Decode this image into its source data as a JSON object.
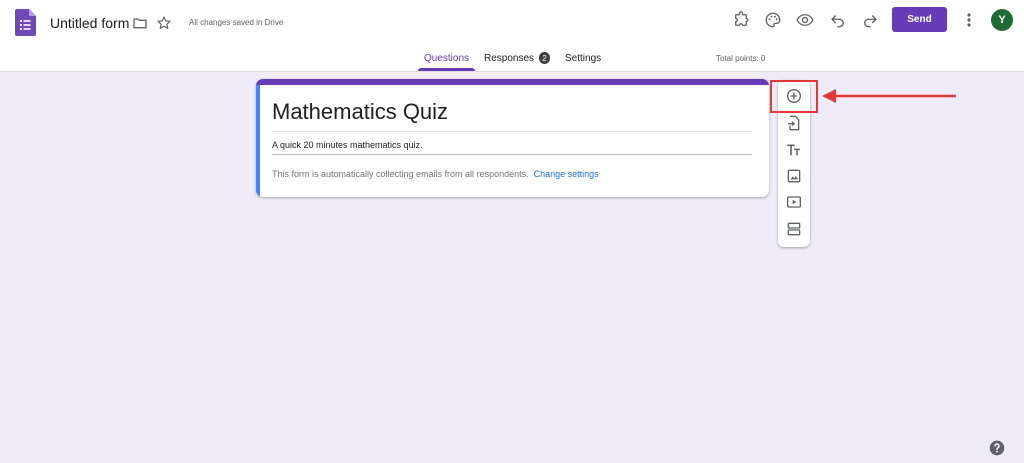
{
  "header": {
    "doc_title": "Untitled form",
    "save_status": "All changes saved in Drive",
    "send_label": "Send",
    "avatar_initial": "Y",
    "icons": [
      "forms-logo-icon",
      "folder-icon",
      "star-icon",
      "addon-puzzle-icon",
      "palette-icon",
      "preview-eye-icon",
      "undo-icon",
      "redo-icon",
      "more-vert-icon"
    ]
  },
  "tabs": [
    {
      "label": "Questions",
      "active": true
    },
    {
      "label": "Responses",
      "badge": "2"
    },
    {
      "label": "Settings"
    }
  ],
  "total_points": "Total points: 0",
  "form": {
    "title": "Mathematics Quiz",
    "description": "A quick 20 minutes mathematics quiz.",
    "email_note": "This form is automatically collecting emails from all respondents.",
    "email_link": "Change settings"
  },
  "toolbar": [
    "add-question-icon",
    "import-questions-icon",
    "add-title-description-icon",
    "add-image-icon",
    "add-video-icon",
    "add-section-icon"
  ],
  "colors": {
    "accent": "#673ab7",
    "background": "#f0ebf8",
    "annotation": "#e53935",
    "link": "#1a73e8"
  }
}
